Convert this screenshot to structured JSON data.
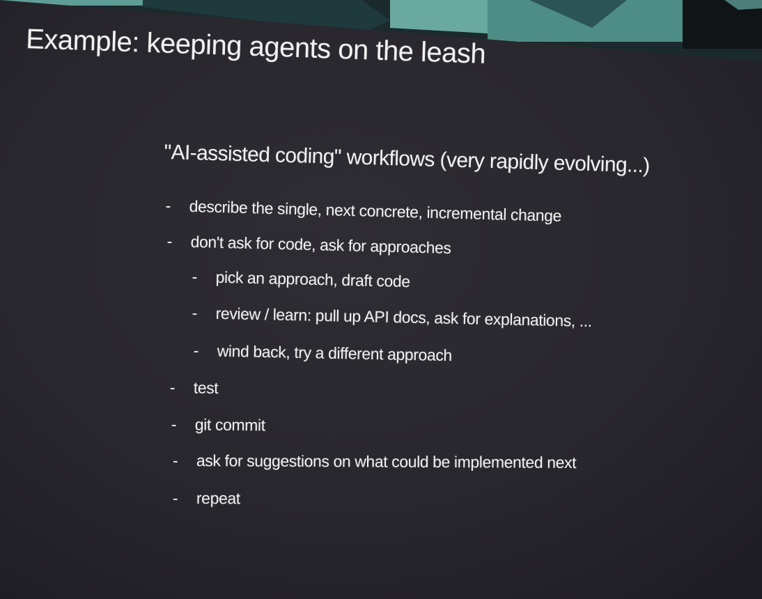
{
  "slide": {
    "title": "Example: keeping agents on the leash",
    "subtitle": "\"AI-assisted coding\" workflows (very rapidly evolving...)",
    "bullets": [
      {
        "marker": "-",
        "text": "describe the single, next concrete, incremental change"
      },
      {
        "marker": "-",
        "text": "don't ask for code, ask for approaches"
      },
      {
        "marker": "-",
        "text": "pick an approach, draft code"
      },
      {
        "marker": "-",
        "text": "review / learn: pull up API docs, ask for explanations, ..."
      },
      {
        "marker": "-",
        "text": "wind back, try a different approach"
      },
      {
        "marker": "-",
        "text": "test"
      },
      {
        "marker": "-",
        "text": "git commit"
      },
      {
        "marker": "-",
        "text": "ask for suggestions on what could be implemented next"
      },
      {
        "marker": "-",
        "text": "repeat"
      }
    ]
  },
  "colors": {
    "background": "#26252b",
    "text": "#f2f2f2",
    "backdrop_teal": "#5f9e96",
    "backdrop_dark": "#1f3a3c"
  }
}
